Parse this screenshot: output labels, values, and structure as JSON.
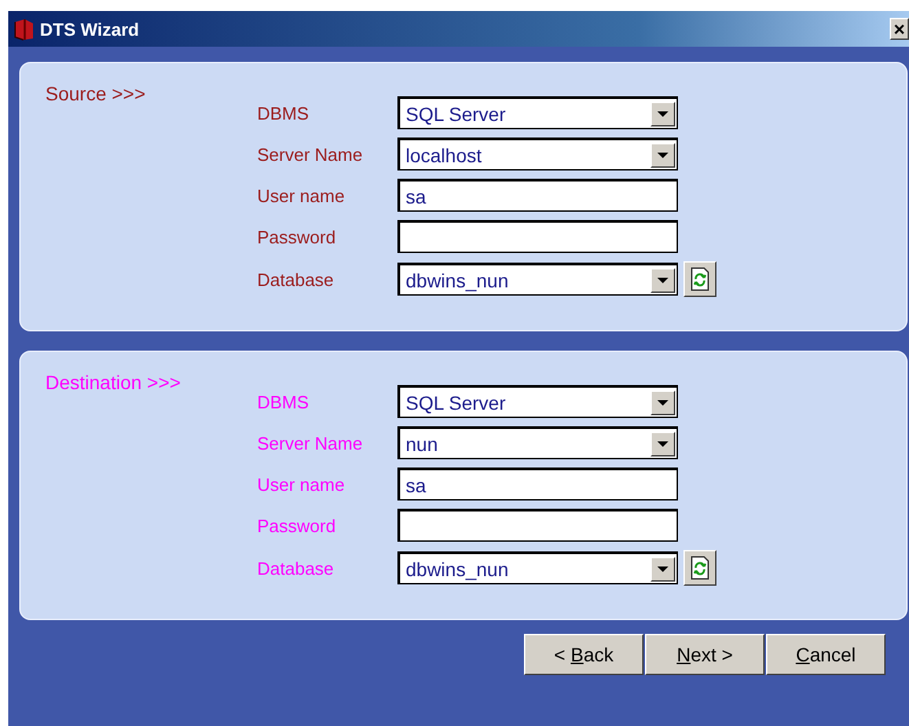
{
  "window": {
    "title": "DTS Wizard",
    "close": "×"
  },
  "sections": [
    {
      "title": "Source >>>",
      "color": "#9b1c1c",
      "fields": [
        {
          "label": "DBMS",
          "kind": "combo",
          "value": "SQL Server"
        },
        {
          "label": "Server Name",
          "kind": "combo",
          "value": "localhost"
        },
        {
          "label": "User name",
          "kind": "text",
          "value": "sa"
        },
        {
          "label": "Password",
          "kind": "text"
        },
        {
          "label": "Database",
          "kind": "combo_refresh",
          "value": "dbwins_nun"
        }
      ]
    },
    {
      "title": "Destination >>>",
      "color": "#ff00ff",
      "fields": [
        {
          "label": "DBMS",
          "kind": "combo",
          "value": "SQL Server"
        },
        {
          "label": "Server Name",
          "kind": "combo",
          "value": "nun"
        },
        {
          "label": "User name",
          "kind": "text",
          "value": "sa"
        },
        {
          "label": "Password",
          "kind": "text"
        },
        {
          "label": "Database",
          "kind": "combo_refresh",
          "value": "dbwins_nun"
        }
      ]
    }
  ],
  "buttons": [
    {
      "prefix": "< ",
      "key": "B",
      "suffix": "ack"
    },
    {
      "key": "N",
      "suffix": "ext >"
    },
    {
      "key": "C",
      "suffix": "ancel"
    }
  ]
}
